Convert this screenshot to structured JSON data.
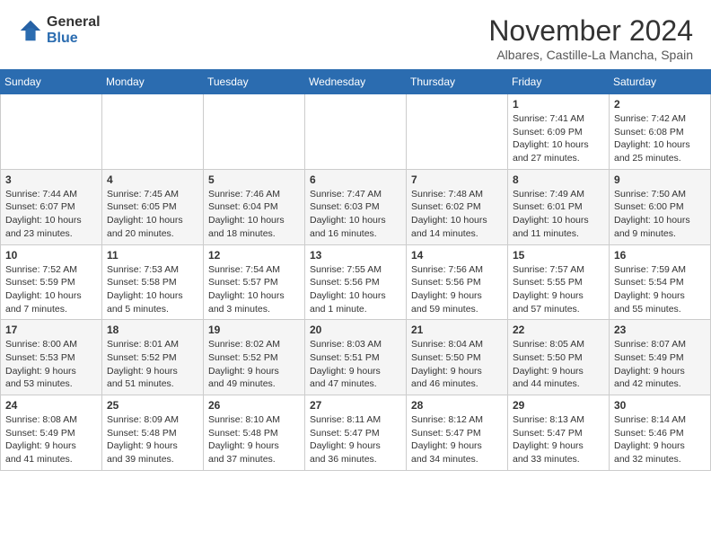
{
  "header": {
    "logo_general": "General",
    "logo_blue": "Blue",
    "month_title": "November 2024",
    "location": "Albares, Castille-La Mancha, Spain"
  },
  "days_of_week": [
    "Sunday",
    "Monday",
    "Tuesday",
    "Wednesday",
    "Thursday",
    "Friday",
    "Saturday"
  ],
  "weeks": [
    [
      {
        "day": "",
        "info": ""
      },
      {
        "day": "",
        "info": ""
      },
      {
        "day": "",
        "info": ""
      },
      {
        "day": "",
        "info": ""
      },
      {
        "day": "",
        "info": ""
      },
      {
        "day": "1",
        "info": "Sunrise: 7:41 AM\nSunset: 6:09 PM\nDaylight: 10 hours\nand 27 minutes."
      },
      {
        "day": "2",
        "info": "Sunrise: 7:42 AM\nSunset: 6:08 PM\nDaylight: 10 hours\nand 25 minutes."
      }
    ],
    [
      {
        "day": "3",
        "info": "Sunrise: 7:44 AM\nSunset: 6:07 PM\nDaylight: 10 hours\nand 23 minutes."
      },
      {
        "day": "4",
        "info": "Sunrise: 7:45 AM\nSunset: 6:05 PM\nDaylight: 10 hours\nand 20 minutes."
      },
      {
        "day": "5",
        "info": "Sunrise: 7:46 AM\nSunset: 6:04 PM\nDaylight: 10 hours\nand 18 minutes."
      },
      {
        "day": "6",
        "info": "Sunrise: 7:47 AM\nSunset: 6:03 PM\nDaylight: 10 hours\nand 16 minutes."
      },
      {
        "day": "7",
        "info": "Sunrise: 7:48 AM\nSunset: 6:02 PM\nDaylight: 10 hours\nand 14 minutes."
      },
      {
        "day": "8",
        "info": "Sunrise: 7:49 AM\nSunset: 6:01 PM\nDaylight: 10 hours\nand 11 minutes."
      },
      {
        "day": "9",
        "info": "Sunrise: 7:50 AM\nSunset: 6:00 PM\nDaylight: 10 hours\nand 9 minutes."
      }
    ],
    [
      {
        "day": "10",
        "info": "Sunrise: 7:52 AM\nSunset: 5:59 PM\nDaylight: 10 hours\nand 7 minutes."
      },
      {
        "day": "11",
        "info": "Sunrise: 7:53 AM\nSunset: 5:58 PM\nDaylight: 10 hours\nand 5 minutes."
      },
      {
        "day": "12",
        "info": "Sunrise: 7:54 AM\nSunset: 5:57 PM\nDaylight: 10 hours\nand 3 minutes."
      },
      {
        "day": "13",
        "info": "Sunrise: 7:55 AM\nSunset: 5:56 PM\nDaylight: 10 hours\nand 1 minute."
      },
      {
        "day": "14",
        "info": "Sunrise: 7:56 AM\nSunset: 5:56 PM\nDaylight: 9 hours\nand 59 minutes."
      },
      {
        "day": "15",
        "info": "Sunrise: 7:57 AM\nSunset: 5:55 PM\nDaylight: 9 hours\nand 57 minutes."
      },
      {
        "day": "16",
        "info": "Sunrise: 7:59 AM\nSunset: 5:54 PM\nDaylight: 9 hours\nand 55 minutes."
      }
    ],
    [
      {
        "day": "17",
        "info": "Sunrise: 8:00 AM\nSunset: 5:53 PM\nDaylight: 9 hours\nand 53 minutes."
      },
      {
        "day": "18",
        "info": "Sunrise: 8:01 AM\nSunset: 5:52 PM\nDaylight: 9 hours\nand 51 minutes."
      },
      {
        "day": "19",
        "info": "Sunrise: 8:02 AM\nSunset: 5:52 PM\nDaylight: 9 hours\nand 49 minutes."
      },
      {
        "day": "20",
        "info": "Sunrise: 8:03 AM\nSunset: 5:51 PM\nDaylight: 9 hours\nand 47 minutes."
      },
      {
        "day": "21",
        "info": "Sunrise: 8:04 AM\nSunset: 5:50 PM\nDaylight: 9 hours\nand 46 minutes."
      },
      {
        "day": "22",
        "info": "Sunrise: 8:05 AM\nSunset: 5:50 PM\nDaylight: 9 hours\nand 44 minutes."
      },
      {
        "day": "23",
        "info": "Sunrise: 8:07 AM\nSunset: 5:49 PM\nDaylight: 9 hours\nand 42 minutes."
      }
    ],
    [
      {
        "day": "24",
        "info": "Sunrise: 8:08 AM\nSunset: 5:49 PM\nDaylight: 9 hours\nand 41 minutes."
      },
      {
        "day": "25",
        "info": "Sunrise: 8:09 AM\nSunset: 5:48 PM\nDaylight: 9 hours\nand 39 minutes."
      },
      {
        "day": "26",
        "info": "Sunrise: 8:10 AM\nSunset: 5:48 PM\nDaylight: 9 hours\nand 37 minutes."
      },
      {
        "day": "27",
        "info": "Sunrise: 8:11 AM\nSunset: 5:47 PM\nDaylight: 9 hours\nand 36 minutes."
      },
      {
        "day": "28",
        "info": "Sunrise: 8:12 AM\nSunset: 5:47 PM\nDaylight: 9 hours\nand 34 minutes."
      },
      {
        "day": "29",
        "info": "Sunrise: 8:13 AM\nSunset: 5:47 PM\nDaylight: 9 hours\nand 33 minutes."
      },
      {
        "day": "30",
        "info": "Sunrise: 8:14 AM\nSunset: 5:46 PM\nDaylight: 9 hours\nand 32 minutes."
      }
    ]
  ]
}
